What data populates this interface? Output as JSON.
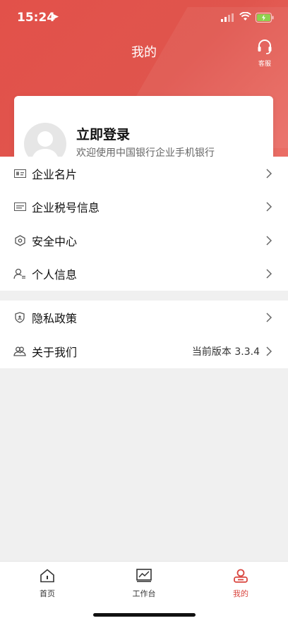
{
  "status_bar": {
    "time": "15:24"
  },
  "header": {
    "title": "我的",
    "service_label": "客服"
  },
  "login_card": {
    "title": "立即登录",
    "subtitle": "欢迎使用中国银行企业手机银行"
  },
  "menu_group_1": [
    {
      "label": "企业名片",
      "icon": "business-card-icon"
    },
    {
      "label": "企业税号信息",
      "icon": "tax-id-icon"
    },
    {
      "label": "安全中心",
      "icon": "security-hexagon-icon"
    },
    {
      "label": "个人信息",
      "icon": "person-info-icon"
    }
  ],
  "menu_group_2": [
    {
      "label": "隐私政策",
      "icon": "privacy-shield-icon"
    },
    {
      "label": "关于我们",
      "icon": "about-users-icon",
      "extra": "当前版本 3.3.4"
    }
  ],
  "tabbar": [
    {
      "label": "首页",
      "icon": "home-icon"
    },
    {
      "label": "工作台",
      "icon": "workbench-chart-icon"
    },
    {
      "label": "我的",
      "icon": "profile-icon",
      "active": true
    }
  ],
  "colors": {
    "brand_red": "#e2514a",
    "active_tab": "#d9463f",
    "background": "#f0f0f0"
  }
}
